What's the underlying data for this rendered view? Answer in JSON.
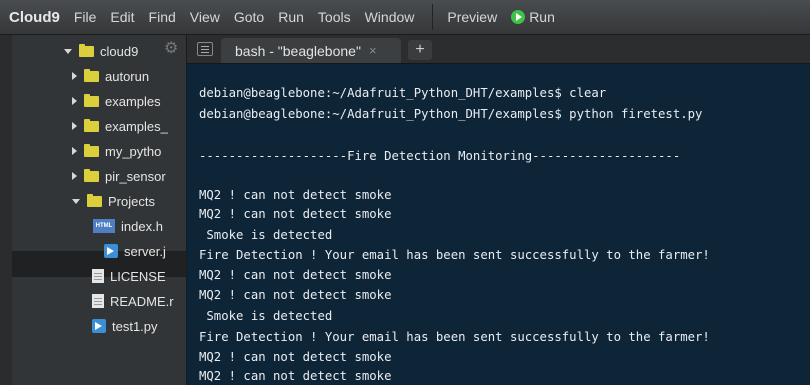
{
  "menubar": {
    "brand": "Cloud9",
    "items": [
      "File",
      "Edit",
      "Find",
      "View",
      "Goto",
      "Run",
      "Tools",
      "Window"
    ],
    "preview": "Preview",
    "run": "Run"
  },
  "sidebar": {
    "root": "cloud9",
    "items": [
      {
        "label": "autorun",
        "type": "folder",
        "state": "collapsed"
      },
      {
        "label": "examples",
        "type": "folder",
        "state": "collapsed"
      },
      {
        "label": "examples_",
        "type": "folder",
        "state": "collapsed"
      },
      {
        "label": "my_pytho",
        "type": "folder",
        "state": "collapsed"
      },
      {
        "label": "pir_sensor",
        "type": "folder",
        "state": "collapsed"
      },
      {
        "label": "Projects",
        "type": "folder",
        "state": "expanded"
      },
      {
        "label": "index.h",
        "type": "html"
      },
      {
        "label": "server.j",
        "type": "js"
      },
      {
        "label": "LICENSE",
        "type": "doc"
      },
      {
        "label": "README.r",
        "type": "doc"
      },
      {
        "label": "test1.py",
        "type": "js"
      }
    ]
  },
  "tab": {
    "label": "bash - \"beaglebone\"",
    "close": "×",
    "add": "+"
  },
  "terminal": {
    "lines": [
      "debian@beaglebone:~/Adafruit_Python_DHT/examples$ clear",
      "debian@beaglebone:~/Adafruit_Python_DHT/examples$ python firetest.py",
      "",
      "--------------------Fire Detection Monitoring--------------------",
      "",
      "MQ2 ! can not detect smoke",
      "MQ2 ! can not detect smoke",
      " Smoke is detected",
      "Fire Detection ! Your email has been sent successfully to the farmer!",
      "MQ2 ! can not detect smoke",
      "MQ2 ! can not detect smoke",
      " Smoke is detected",
      "Fire Detection ! Your email has been sent successfully to the farmer!",
      "MQ2 ! can not detect smoke",
      "MQ2 ! can not detect smoke"
    ]
  }
}
